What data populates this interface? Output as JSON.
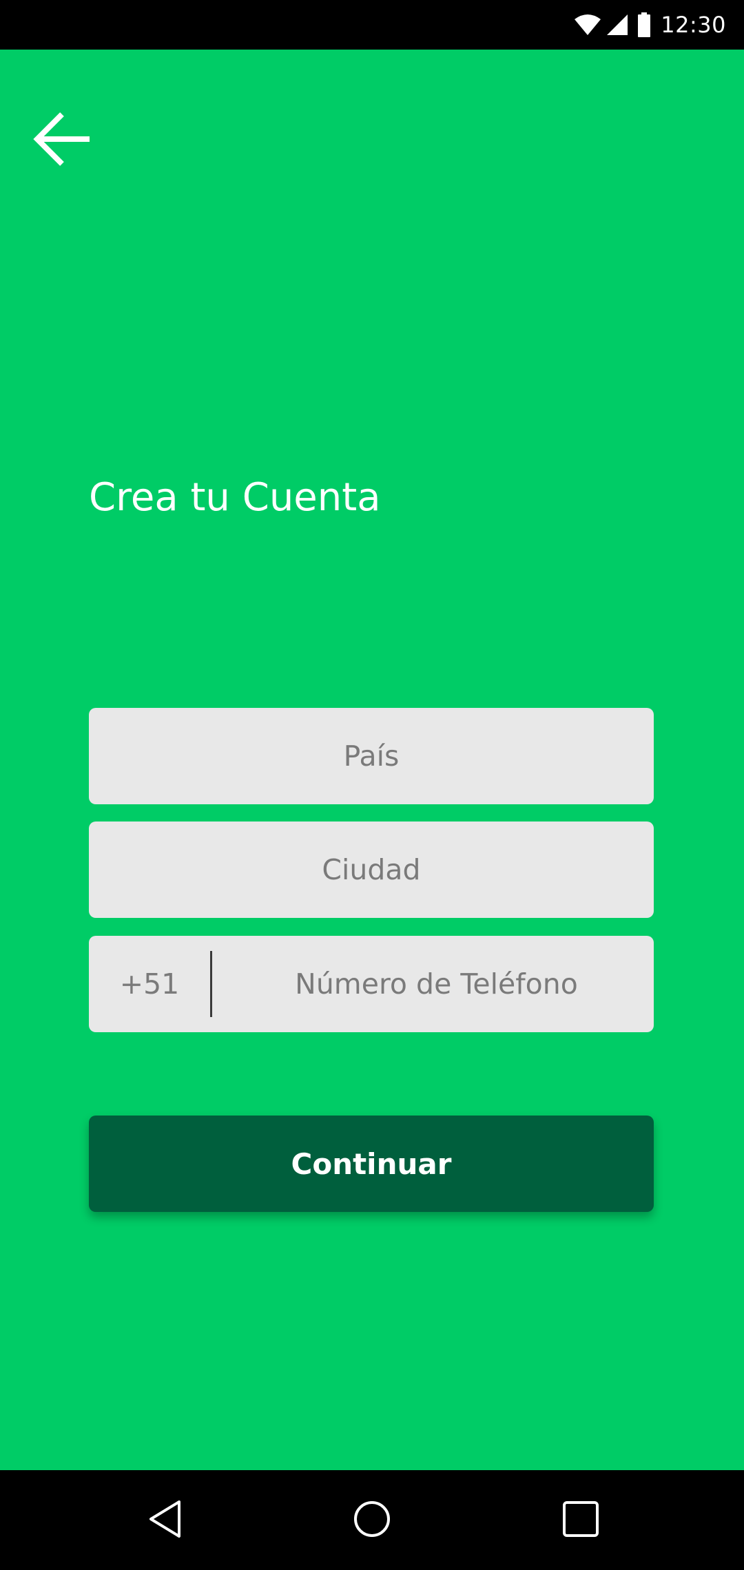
{
  "status_bar": {
    "time": "12:30",
    "icons": [
      "wifi-icon",
      "cell-signal-icon",
      "battery-icon"
    ]
  },
  "colors": {
    "background": "#00cc66",
    "field_background": "#e8e8e8",
    "button_background": "#005f3d",
    "text_light": "#ffffff",
    "placeholder": "#7a7a7a"
  },
  "header": {
    "back_icon": "arrow-left-icon"
  },
  "form": {
    "title": "Crea tu Cuenta",
    "country_placeholder": "País",
    "city_placeholder": "Ciudad",
    "phone_prefix": "+51",
    "phone_placeholder": "Número de Teléfono",
    "continue_label": "Continuar"
  },
  "nav_bar": {
    "icons": [
      "nav-back-icon",
      "nav-home-icon",
      "nav-recents-icon"
    ]
  }
}
